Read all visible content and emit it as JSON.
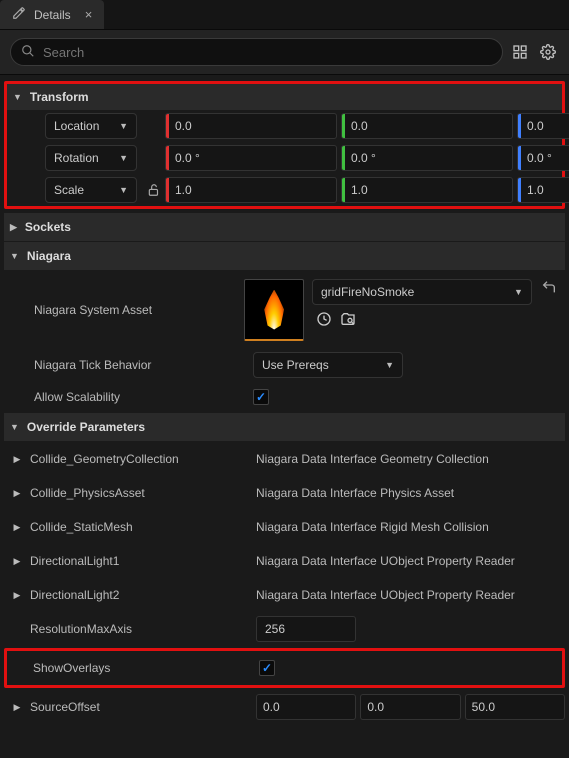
{
  "tab": {
    "title": "Details"
  },
  "search": {
    "placeholder": "Search"
  },
  "transform": {
    "title": "Transform",
    "location": {
      "label": "Location",
      "x": "0.0",
      "y": "0.0",
      "z": "0.0"
    },
    "rotation": {
      "label": "Rotation",
      "x": "0.0 °",
      "y": "0.0 °",
      "z": "0.0 °"
    },
    "scale": {
      "label": "Scale",
      "x": "1.0",
      "y": "1.0",
      "z": "1.0"
    }
  },
  "sockets": {
    "title": "Sockets"
  },
  "niagara": {
    "title": "Niagara",
    "assetLabel": "Niagara System Asset",
    "assetValue": "gridFireNoSmoke",
    "tickLabel": "Niagara Tick Behavior",
    "tickValue": "Use Prereqs",
    "allowScalabilityLabel": "Allow Scalability"
  },
  "override": {
    "title": "Override Parameters",
    "params": [
      {
        "label": "Collide_GeometryCollection",
        "value": "Niagara Data Interface Geometry Collection",
        "expand": true
      },
      {
        "label": "Collide_PhysicsAsset",
        "value": "Niagara Data Interface Physics Asset",
        "expand": true
      },
      {
        "label": "Collide_StaticMesh",
        "value": "Niagara Data Interface Rigid Mesh Collision",
        "expand": true
      },
      {
        "label": "DirectionalLight1",
        "value": "Niagara Data Interface UObject Property Reader",
        "expand": true
      },
      {
        "label": "DirectionalLight2",
        "value": "Niagara Data Interface UObject Property Reader",
        "expand": true
      }
    ],
    "resolution": {
      "label": "ResolutionMaxAxis",
      "value": "256"
    },
    "showOverlays": {
      "label": "ShowOverlays"
    },
    "sourceOffset": {
      "label": "SourceOffset",
      "x": "0.0",
      "y": "0.0",
      "z": "50.0"
    }
  }
}
